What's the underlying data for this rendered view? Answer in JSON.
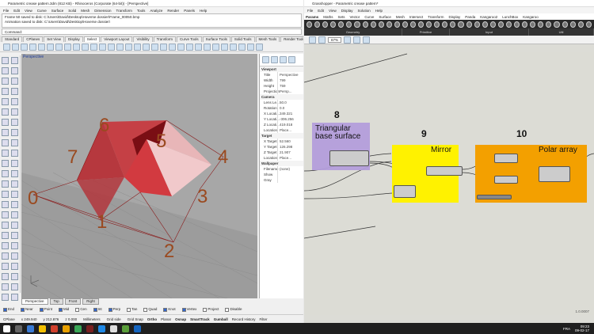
{
  "rhino": {
    "title": "Parametric crease pattern.3dm (812 KB) - Rhinoceros (Corporate (64-bit)) - [Perspective]",
    "menu": [
      "File",
      "Edit",
      "View",
      "Curve",
      "Surface",
      "Solid",
      "Mesh",
      "Dimension",
      "Transform",
      "Tools",
      "Analyze",
      "Render",
      "Panels",
      "Help"
    ],
    "history": [
      "Frame 50 saved to disk: C:\\Users\\David\\Desktop\\Hoverse dossier\\Frame_00050.bmp",
      "Animation saved to disk: C:\\Users\\David\\Desktop\\Hoverse dossier\\"
    ],
    "command_label": "Command:",
    "tabs": [
      "Standard",
      "CPlanes",
      "Set View",
      "Display",
      "Select",
      "Viewport Layout",
      "Visibility",
      "Transform",
      "Curve Tools",
      "Surface Tools",
      "Solid Tools",
      "Mesh Tools",
      "Render Tools",
      "Drafting"
    ],
    "viewport_label": "Perspective",
    "point_labels": [
      "0",
      "1",
      "2",
      "3",
      "4",
      "5",
      "6",
      "7"
    ],
    "viewport_tabs": [
      "Perspective",
      "Top",
      "Front",
      "Right"
    ],
    "osnaps": [
      "End",
      "Near",
      "Point",
      "Mid",
      "Cen",
      "Int",
      "Perp",
      "Tan",
      "Quad",
      "Knot",
      "Vertex",
      "Project",
      "Disable"
    ],
    "status": {
      "cplane": "CPlane",
      "x": "x 249.940",
      "y": "y 212.876",
      "z": "z 0.000",
      "units": "Millimeters",
      "layer": "Grid side",
      "items": [
        "Grid Snap",
        "Ortho",
        "Planar",
        "Osnap",
        "SmartTrack",
        "Gumball",
        "Record History",
        "Filter"
      ]
    }
  },
  "props": {
    "viewport_section": "Viewport",
    "viewport_rows": [
      [
        "Title",
        "Perspective"
      ],
      [
        "Width",
        "799"
      ],
      [
        "Height",
        "759"
      ],
      [
        "Projection",
        "Persp..."
      ]
    ],
    "camera_section": "Camera",
    "camera_rows": [
      [
        "Lens Le...",
        "50.0"
      ],
      [
        "Rotation",
        "0.0"
      ],
      [
        "X Locati...",
        "349.321"
      ],
      [
        "Y Locati...",
        "-306.256"
      ],
      [
        "Z Locati...",
        "419.018"
      ],
      [
        "Location",
        "Place..."
      ]
    ],
    "target_section": "Target",
    "target_rows": [
      [
        "X Target",
        "52.560"
      ],
      [
        "Y Target",
        "126.298"
      ],
      [
        "Z Target",
        "21.907"
      ],
      [
        "Location",
        "Place..."
      ]
    ],
    "wallpaper_section": "Wallpaper",
    "wallpaper_rows": [
      [
        "Filename",
        "(none)"
      ],
      [
        "Show",
        ""
      ],
      [
        "Gray",
        ""
      ]
    ]
  },
  "gh": {
    "title": "Grasshopper - Parametric crease pattern*",
    "menu": [
      "File",
      "Edit",
      "View",
      "Display",
      "Solution",
      "Help"
    ],
    "categories": [
      "Params",
      "Maths",
      "Sets",
      "Vector",
      "Curve",
      "Surface",
      "Mesh",
      "Intersect",
      "Transform",
      "Display",
      "Panda",
      "Kangaroo2",
      "LunchBox",
      "Kangaroo"
    ],
    "subbar": [
      "Geometry",
      "Primitive",
      "Input",
      "Util"
    ],
    "zoom": "67%",
    "groups": [
      {
        "num": "8",
        "title": "Triangular base surface"
      },
      {
        "num": "9",
        "title": "Mirror"
      },
      {
        "num": "10",
        "title": "Polar array"
      }
    ],
    "version": "1.0.0007"
  },
  "taskbar": {
    "time": "09:23",
    "date": "09-02-17",
    "lang": "FRA"
  },
  "colors": {
    "mesh": "#c8383c",
    "gh_group_purple": "#b39ddb",
    "gh_group_yellow": "#fff200",
    "gh_group_orange": "#f3a000",
    "label": "#9a4a20"
  }
}
